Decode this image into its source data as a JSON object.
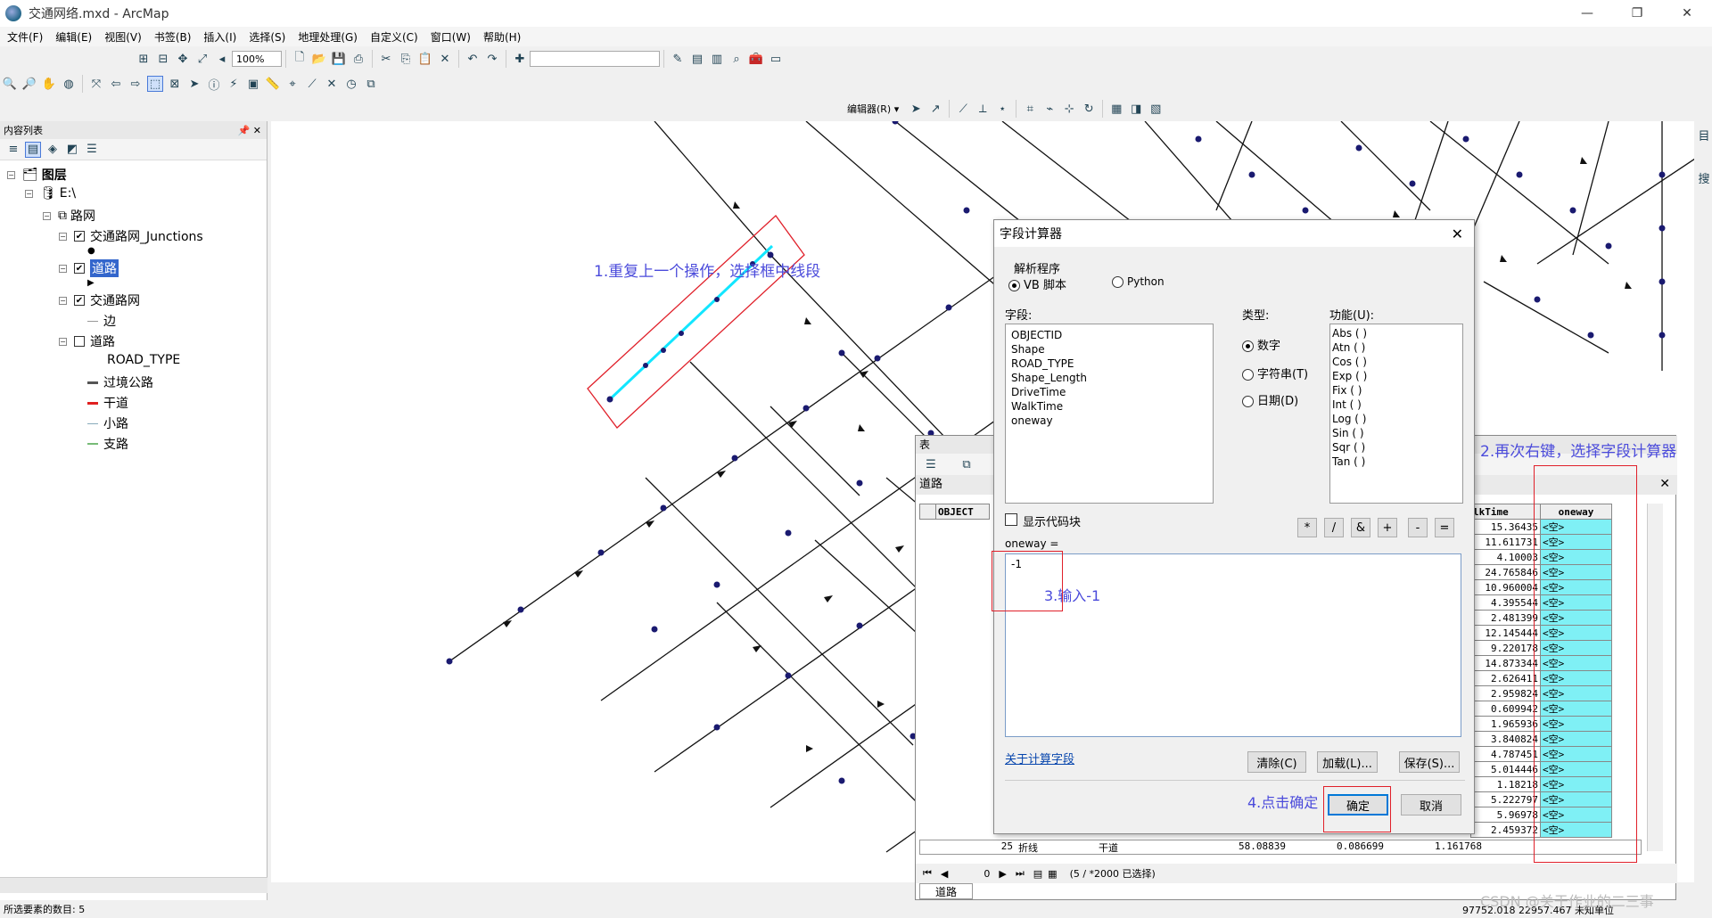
{
  "window": {
    "title": "交通网络.mxd - ArcMap",
    "minimize": "—",
    "restore": "❐",
    "close": "✕"
  },
  "menu": [
    "文件(F)",
    "编辑(E)",
    "视图(V)",
    "书签(B)",
    "插入(I)",
    "选择(S)",
    "地理处理(G)",
    "自定义(C)",
    "窗口(W)",
    "帮助(H)"
  ],
  "toolbar": {
    "zoom": "100%",
    "editor": "编辑器(R) ▾"
  },
  "toc": {
    "header": "内容列表",
    "items": [
      {
        "label": "图层",
        "indent": 0
      },
      {
        "label": "E:\\",
        "indent": 1
      },
      {
        "label": "路网",
        "indent": 2
      },
      {
        "label": "交通路网_Junctions",
        "indent": 3
      },
      {
        "label": "道路",
        "indent": 3
      },
      {
        "label": "交通路网",
        "indent": 3
      },
      {
        "label": "边",
        "indent": 4
      },
      {
        "label": "道路",
        "indent": 3
      },
      {
        "label": "ROAD_TYPE",
        "indent": 4
      },
      {
        "label": "过境公路",
        "indent": 4
      },
      {
        "label": "干道",
        "indent": 4
      },
      {
        "label": "小路",
        "indent": 4
      },
      {
        "label": "支路",
        "indent": 4
      }
    ]
  },
  "dialog": {
    "title": "字段计算器",
    "parser_label": "解析程序",
    "parser_vb": "VB 脚本",
    "parser_py": "Python",
    "fields_label": "字段:",
    "fields": [
      "OBJECTID",
      "Shape",
      "ROAD_TYPE",
      "Shape_Length",
      "DriveTime",
      "WalkTime",
      "oneway"
    ],
    "type_label": "类型:",
    "type_number": "数字",
    "type_string": "字符串(T)",
    "type_date": "日期(D)",
    "func_label": "功能(U):",
    "functions": [
      "Abs ( )",
      "Atn ( )",
      "Cos ( )",
      "Exp ( )",
      "Fix ( )",
      "Int ( )",
      "Log ( )",
      "Sin ( )",
      "Sqr ( )",
      "Tan ( )"
    ],
    "operators": [
      "*",
      "/",
      "&",
      "+",
      "-",
      "="
    ],
    "show_codeblock": "显示代码块",
    "expr_label": "oneway =",
    "expression": "-1",
    "about_link": "关于计算字段",
    "clear": "清除(C)",
    "load": "加载(L)...",
    "save": "保存(S)...",
    "ok": "确定",
    "cancel": "取消"
  },
  "table": {
    "header": "表",
    "layer": "道路",
    "col_objectid": "OBJECT",
    "col_walk": "lkTime",
    "col_oneway": "oneway",
    "walk_values": [
      "15.36435",
      "11.611731",
      "4.10003",
      "24.765846",
      "10.960004",
      "4.395544",
      "2.481399",
      "12.145444",
      "9.220178",
      "14.873344",
      "2.626411",
      "2.959824",
      "0.609942",
      "1.965936",
      "3.840824",
      "4.787451",
      "5.014446",
      "1.18218",
      "5.222797",
      "5.96978",
      "2.459372",
      "1.161768"
    ],
    "oneway_value": "<空>",
    "last_row": {
      "id": "25",
      "shape": "折线",
      "type": "干道",
      "length": "58.08839",
      "drive": "0.086699",
      "walk": "1.161768"
    },
    "nav_record": "0",
    "selection": "(5 / *2000 已选择)",
    "tab": "道路"
  },
  "annotations": {
    "a1": "1.重复上一个操作，选择框中线段",
    "a2": "2.再次右键，选择字段计算器",
    "a3": "3.输入-1",
    "a4": "4.点击确定"
  },
  "status": {
    "left": "所选要素的数目: 5",
    "right": "97752.018  22957.467 未知单位",
    "watermark": "CSDN @关于作业的二三事"
  },
  "colors": {
    "accent": "#4b4bdb",
    "redbox": "#e0202a",
    "cyan_line": "#12e6ff",
    "node": "#1a1a70",
    "table_oneway": "#7ff0f5"
  }
}
